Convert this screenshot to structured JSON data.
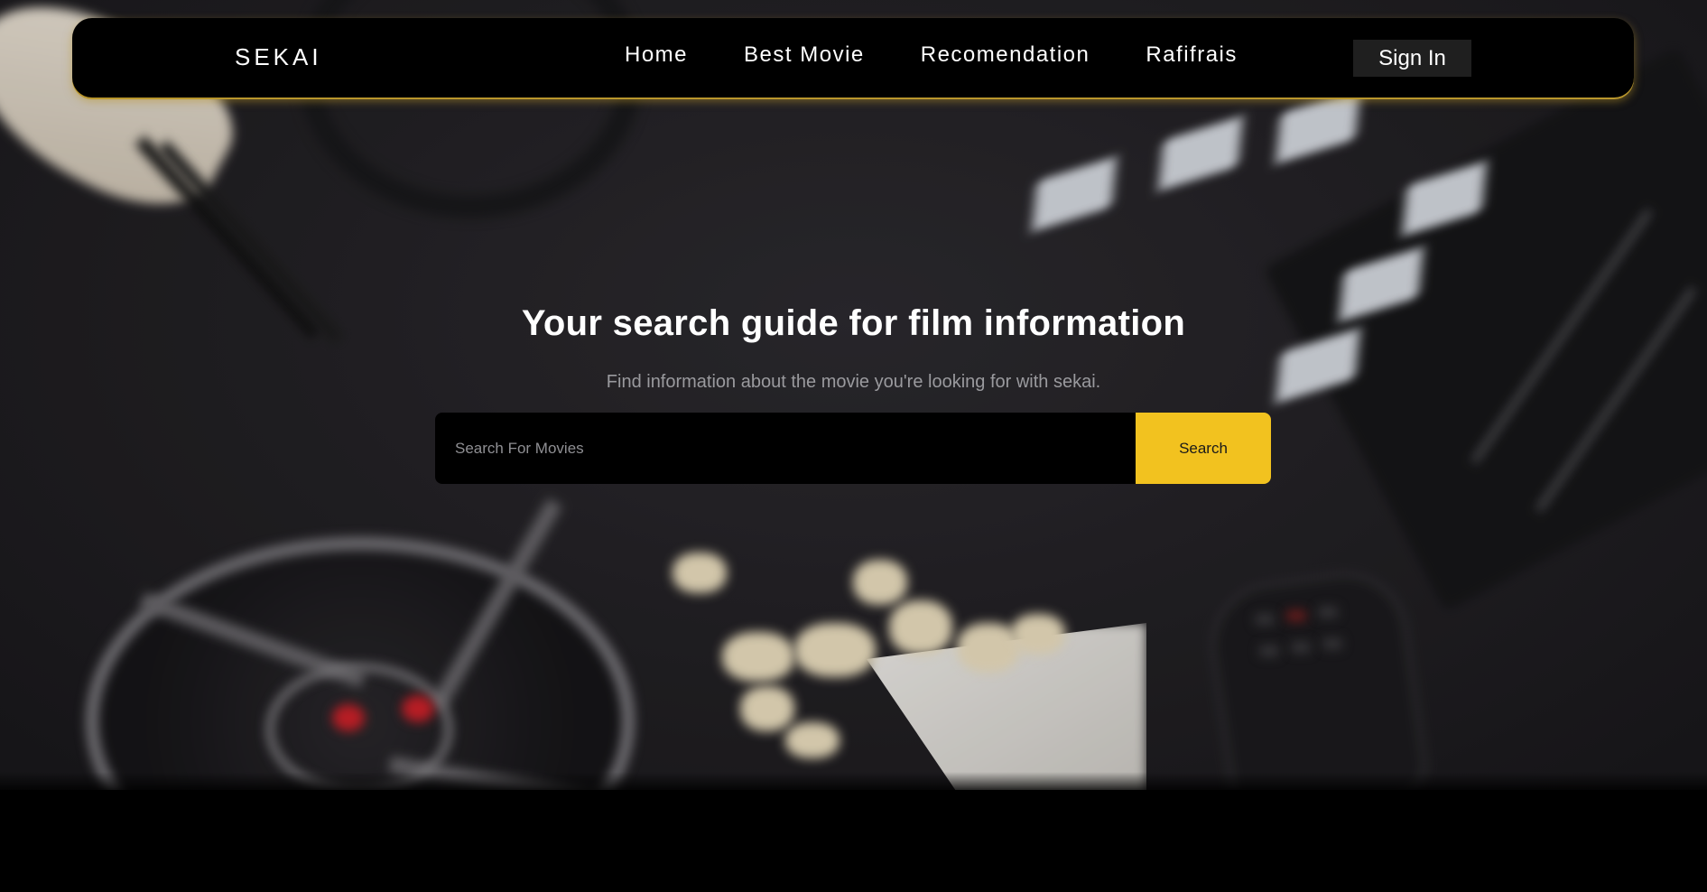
{
  "brand": {
    "name": "SEKAI"
  },
  "nav": {
    "links": [
      {
        "label": "Home"
      },
      {
        "label": "Best Movie"
      },
      {
        "label": "Recomendation"
      },
      {
        "label": "Rafifrais"
      }
    ],
    "signin_label": "Sign In"
  },
  "hero": {
    "title": "Your search guide for film information",
    "subtitle": "Find information about the movie you're looking for with sekai.",
    "search": {
      "placeholder": "Search For Movies",
      "value": "",
      "button_label": "Search"
    }
  },
  "colors": {
    "accent": "#f2c21f",
    "nav_glow": "#b9962c",
    "background": "#000000"
  }
}
